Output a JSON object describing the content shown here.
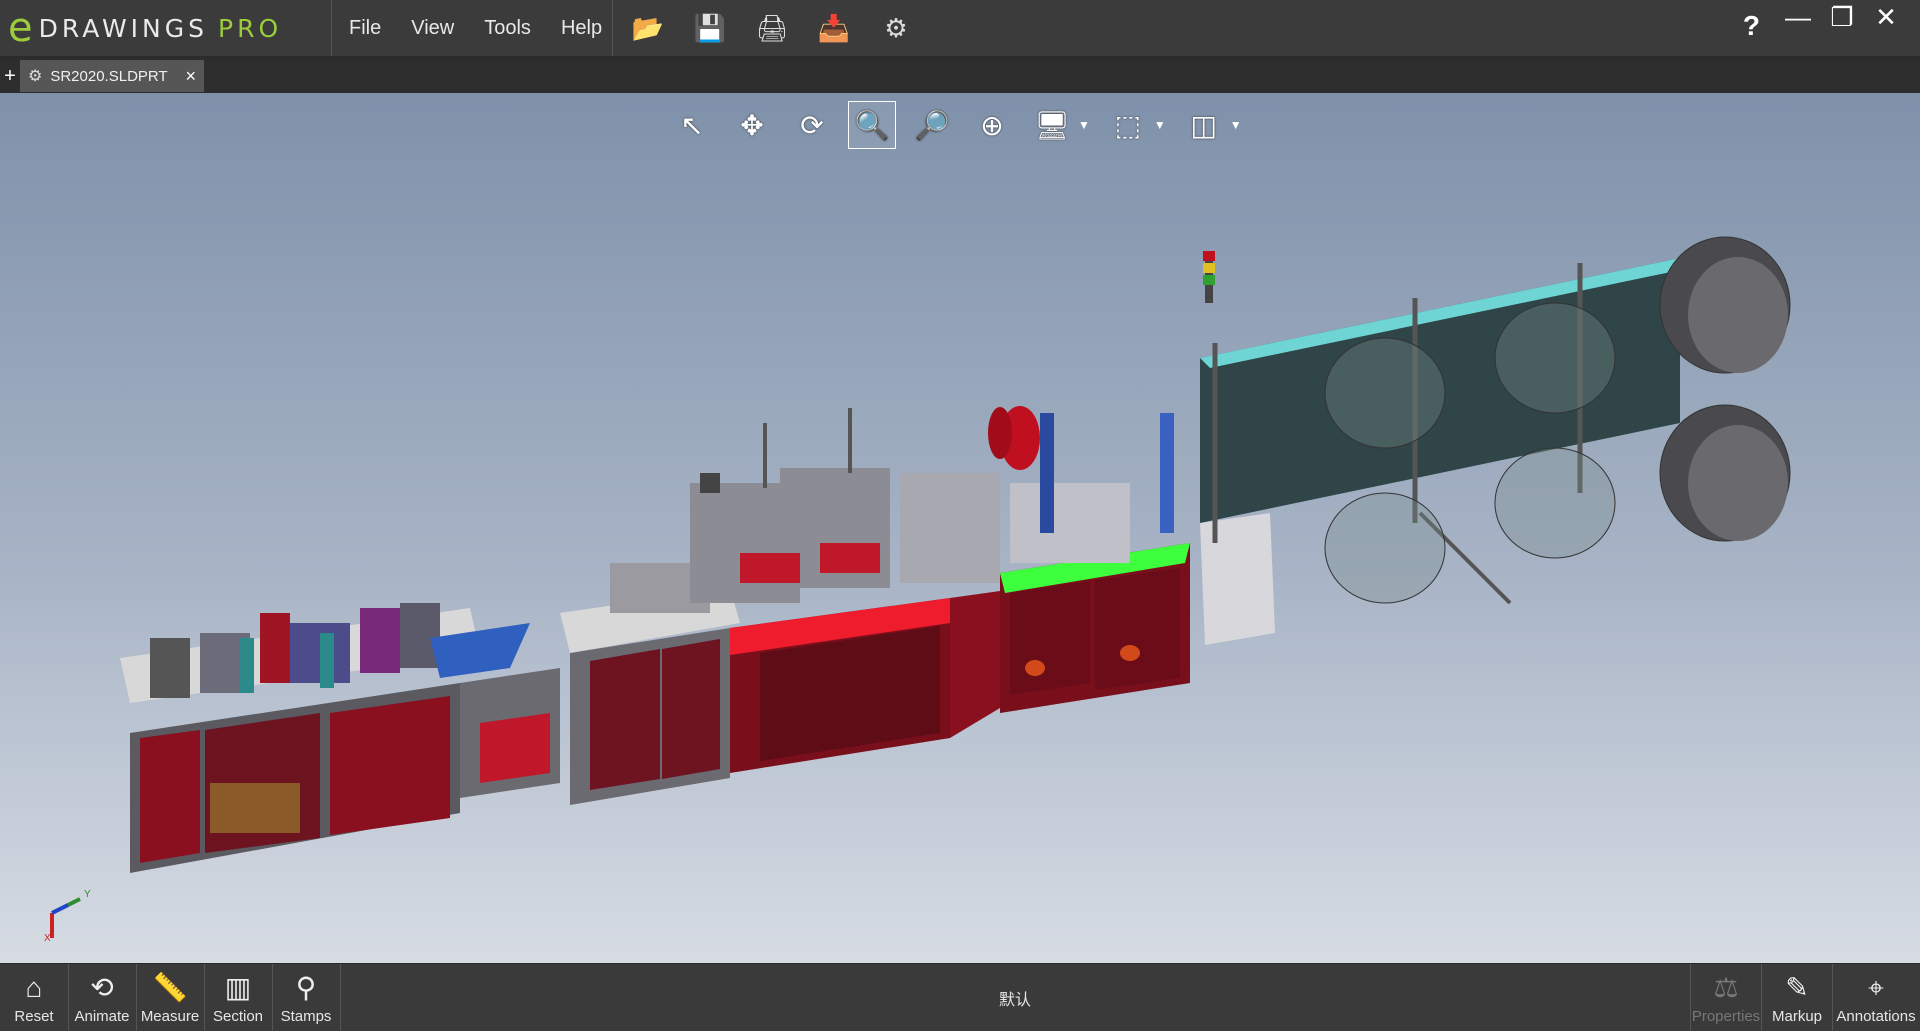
{
  "app": {
    "logo_main": "DRAWINGS",
    "logo_suffix": "PRO",
    "logo_mark": "e"
  },
  "menu": [
    "File",
    "View",
    "Tools",
    "Help"
  ],
  "quick_tools": [
    {
      "name": "open-icon",
      "glyph": "📂"
    },
    {
      "name": "save-icon",
      "glyph": "💾"
    },
    {
      "name": "print-icon",
      "glyph": "🖨"
    },
    {
      "name": "publish-icon",
      "glyph": "📥"
    },
    {
      "name": "settings-icon",
      "glyph": "⚙"
    }
  ],
  "window": {
    "help": "?",
    "minimize": "—",
    "restore": "❐",
    "close": "✕"
  },
  "tabs": {
    "add": "+",
    "file": "SR2020.SLDPRT",
    "close": "×"
  },
  "viewport_tools": [
    {
      "name": "select-icon",
      "glyph": "↖"
    },
    {
      "name": "pan-icon",
      "glyph": "✥"
    },
    {
      "name": "rotate-icon",
      "glyph": "⟳"
    },
    {
      "name": "zoom-icon",
      "glyph": "🔍"
    },
    {
      "name": "zoom-to-area-icon",
      "glyph": "🔎"
    },
    {
      "name": "zoom-to-fit-icon",
      "glyph": "⊕"
    },
    {
      "name": "display-style-icon",
      "glyph": "🖥"
    },
    {
      "name": "view-orientation-icon",
      "glyph": "⬚"
    },
    {
      "name": "standard-views-icon",
      "glyph": "◫"
    }
  ],
  "active_tool": "zoom-icon",
  "bottom_left": [
    {
      "label": "Reset",
      "icon": "home-icon",
      "glyph": "⌂"
    },
    {
      "label": "Animate",
      "icon": "animate-icon",
      "glyph": "⟲"
    },
    {
      "label": "Measure",
      "icon": "measure-icon",
      "glyph": "📏"
    },
    {
      "label": "Section",
      "icon": "section-icon",
      "glyph": "▥"
    },
    {
      "label": "Stamps",
      "icon": "stamps-icon",
      "glyph": "⚲"
    }
  ],
  "configuration": "默认",
  "bottom_right": [
    {
      "label": "Properties",
      "icon": "properties-icon",
      "glyph": "⚖",
      "disabled": true
    },
    {
      "label": "Markup",
      "icon": "markup-icon",
      "glyph": "✎",
      "disabled": false
    },
    {
      "label": "Annotations",
      "icon": "annotations-icon",
      "glyph": "⌖",
      "disabled": false
    }
  ],
  "triad": {
    "x": "X",
    "y": "Y"
  },
  "colors": {
    "accent": "#9ccc3c",
    "machine_red": "#8a1020",
    "guard_green": "#3dff3d",
    "frame_dark": "#2f4548"
  }
}
